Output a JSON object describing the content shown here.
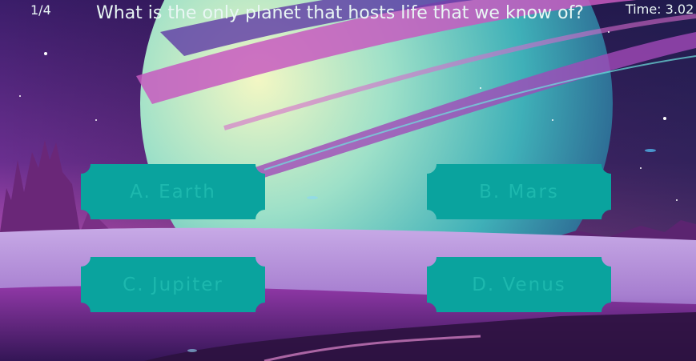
{
  "hud": {
    "question_counter": "1/4",
    "question": "What is the only planet that hosts life that we know of?",
    "timer": "Time: 3.02"
  },
  "answers": [
    {
      "label": "A. Earth"
    },
    {
      "label": "B. Mars"
    },
    {
      "label": "C. Jupiter"
    },
    {
      "label": "D. Venus"
    }
  ],
  "colors": {
    "button_fill": "#0aa39e",
    "button_text": "#1db8ae",
    "sky_top": "#2b1957",
    "ground": "#b58fd8"
  }
}
